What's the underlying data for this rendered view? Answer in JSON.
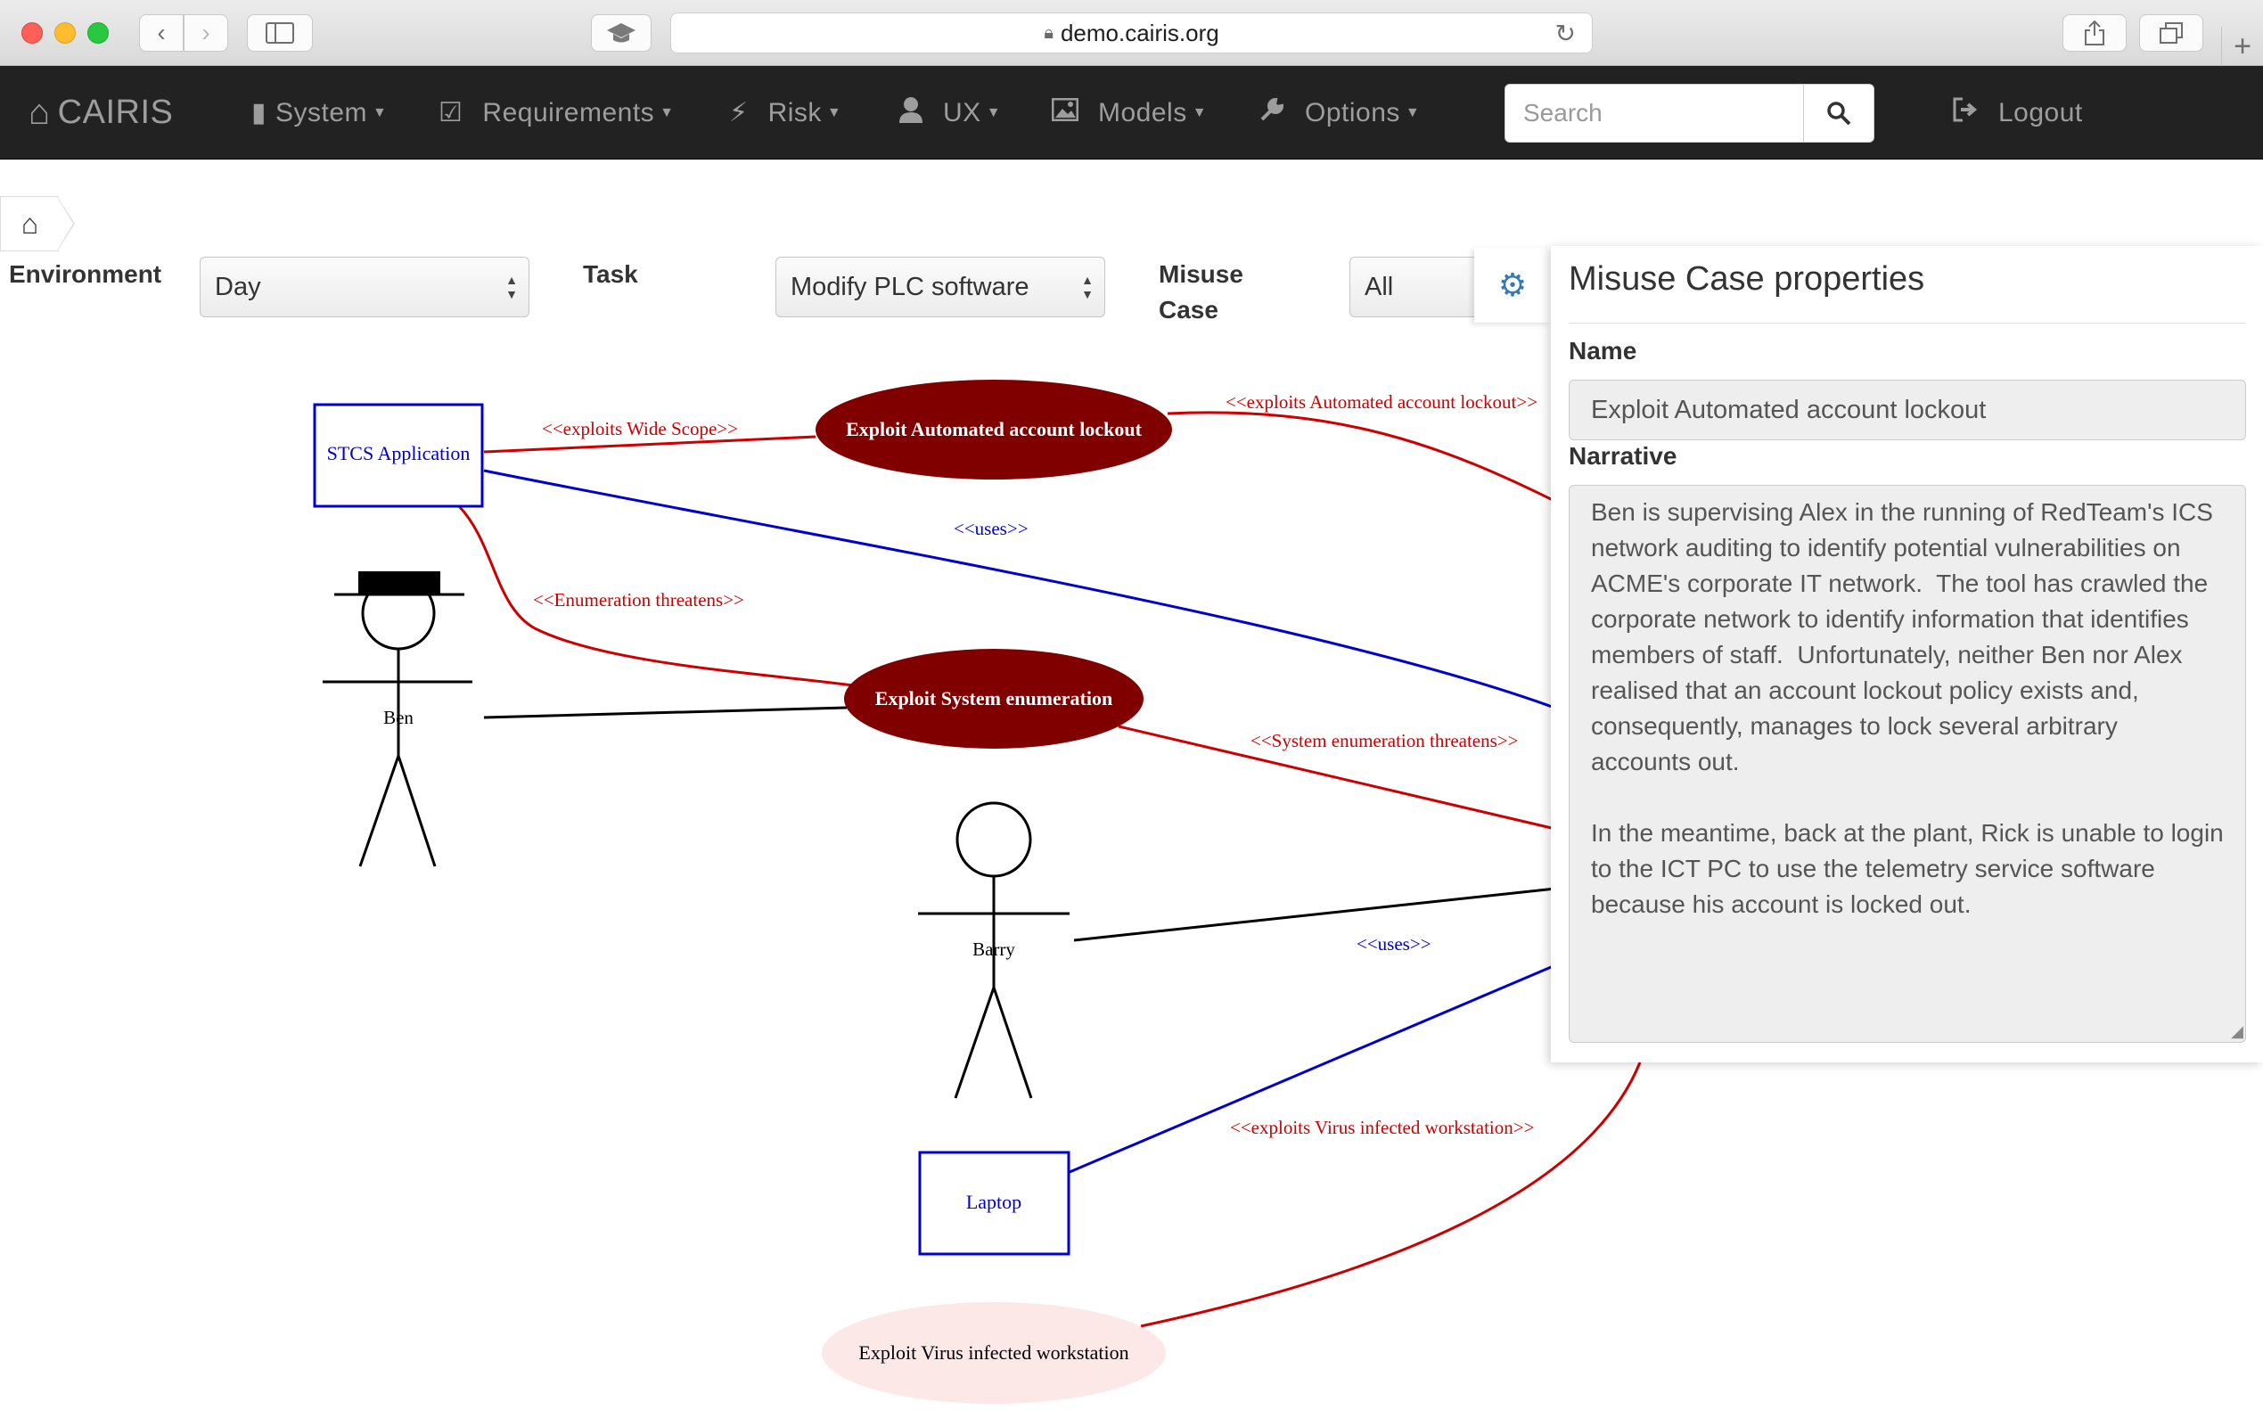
{
  "browser": {
    "url": "demo.cairis.org"
  },
  "navbar": {
    "brand": "CAIRIS",
    "menus": [
      {
        "id": "system",
        "label": "System"
      },
      {
        "id": "requirements",
        "label": "Requirements"
      },
      {
        "id": "risk",
        "label": "Risk"
      },
      {
        "id": "ux",
        "label": "UX"
      },
      {
        "id": "models",
        "label": "Models"
      },
      {
        "id": "options",
        "label": "Options"
      }
    ],
    "search_placeholder": "Search",
    "logout": "Logout"
  },
  "filters": {
    "environment_label": "Environment",
    "environment_value": "Day",
    "task_label": "Task",
    "task_value": "Modify PLC software",
    "misuse_label_line1": "Misuse",
    "misuse_label_line2": "Case",
    "misuse_value": "All"
  },
  "diagram": {
    "assets": [
      "STCS Application",
      "Laptop"
    ],
    "actors": [
      "Ben",
      "Barry"
    ],
    "misuse_cases": [
      "Exploit Automated account lockout",
      "Exploit System enumeration",
      "Exploit Virus infected workstation"
    ],
    "edge_labels": {
      "exploits_wide_scope": "<<exploits Wide Scope>>",
      "exploits_automated_lockout": "<<exploits Automated account lockout>>",
      "uses_top": "<<uses>>",
      "enumeration_threatens": "<<Enumeration threatens>>",
      "system_enumeration_threatens": "<<System enumeration threatens>>",
      "uses_bottom": "<<uses>>",
      "exploits_virus": "<<exploits Virus infected workstation>>"
    },
    "colors": {
      "threat_red": "#cc0000",
      "uses_blue": "#0000cc",
      "misuse_fill": "#800000",
      "misuse_faded_fill": "#fde8e8"
    }
  },
  "panel": {
    "title": "Misuse Case properties",
    "name_label": "Name",
    "name_value": "Exploit Automated account lockout",
    "narrative_label": "Narrative",
    "narrative_value": "Ben is supervising Alex in the running of RedTeam's ICS network auditing to identify potential vulnerabilities on ACME's corporate IT network.  The tool has crawled the corporate network to identify information that identifies members of staff.  Unfortunately, neither Ben nor Alex realised that an account lockout policy exists and, consequently, manages to lock several arbitrary accounts out.\n\nIn the meantime, back at the plant, Rick is unable to login to the ICT PC to use the telemetry service software because his account is locked out."
  }
}
